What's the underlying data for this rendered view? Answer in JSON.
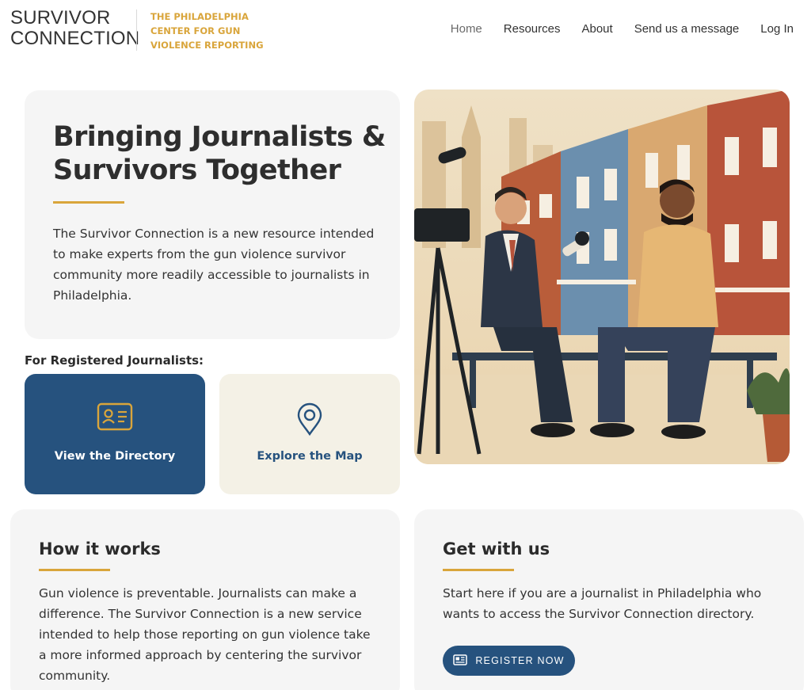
{
  "header": {
    "logo_line1": "SURVIVOR",
    "logo_line2": "CONNECTION",
    "org_line1": "THE PHILADELPHIA",
    "org_line2": "CENTER FOR GUN",
    "org_line3": "VIOLENCE REPORTING",
    "nav": [
      {
        "label": "Home"
      },
      {
        "label": "Resources"
      },
      {
        "label": "About"
      },
      {
        "label": "Send us a message"
      },
      {
        "label": "Log In"
      }
    ]
  },
  "hero": {
    "title": "Bringing Journalists & Survivors Together",
    "description": "The Survivor Connection is a new resource intended to make experts from the gun violence survivor community more readily accessible to journalists in Philadelphia."
  },
  "registered": {
    "label": "For Registered Journalists:",
    "directory_label": "View the Directory",
    "directory_icon": "id-card-icon",
    "map_label": "Explore the Map",
    "map_icon": "map-pin-icon"
  },
  "how_it_works": {
    "title": "How it works",
    "body": "Gun violence is preventable. Journalists can make a difference. The Survivor Connection is a new service intended to help those reporting on gun violence take a more informed approach by centering the survivor community."
  },
  "get_with_us": {
    "title": "Get with us",
    "body": "Start here if you are a journalist in Philadelphia who wants to access the Survivor Connection directory.",
    "button_label": "REGISTER NOW",
    "button_icon": "newspaper-icon"
  },
  "colors": {
    "navy": "#26527e",
    "gold": "#d9a53b",
    "card_gray": "#f5f5f5",
    "cream": "#f4f1e6"
  }
}
